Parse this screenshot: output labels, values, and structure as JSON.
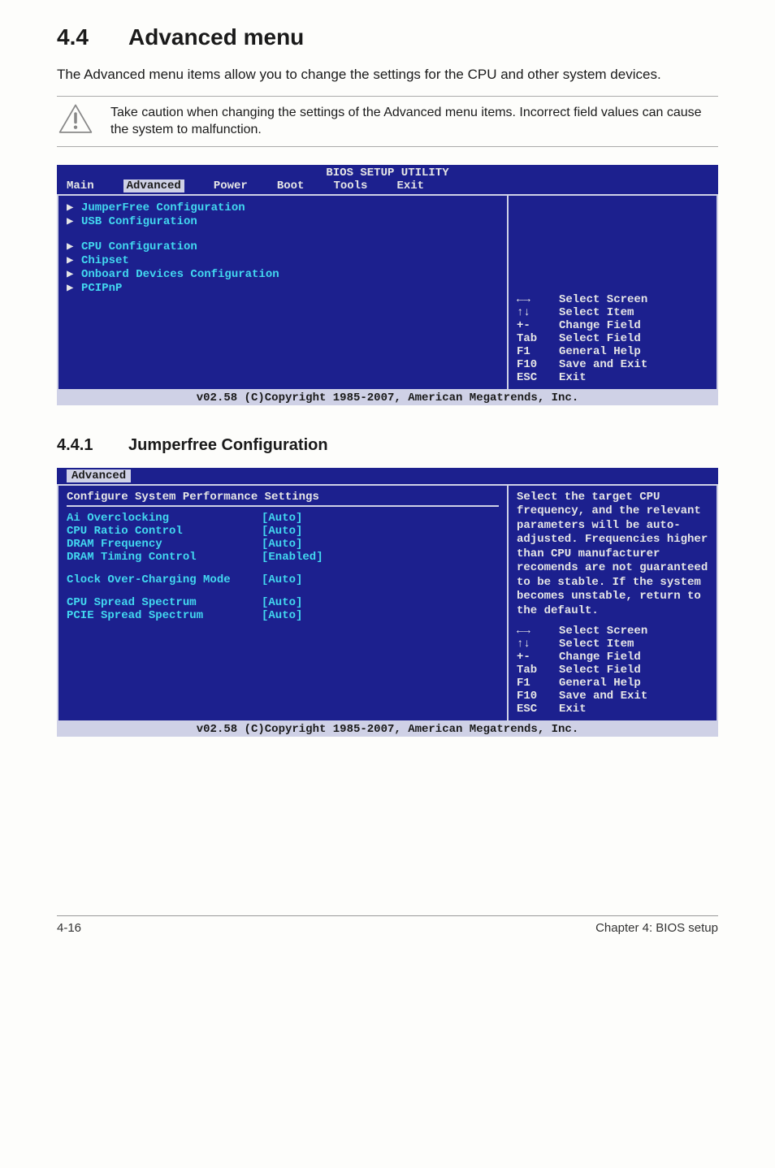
{
  "section": {
    "number": "4.4",
    "title": "Advanced menu",
    "intro": "The Advanced menu items allow you to change the settings for the CPU and other system devices.",
    "caution": "Take caution when changing the settings of the Advanced menu items. Incorrect field values can cause the system to malfunction."
  },
  "bios1": {
    "title": "BIOS SETUP UTILITY",
    "tabs": [
      "Main",
      "Advanced",
      "Power",
      "Boot",
      "Tools",
      "Exit"
    ],
    "activeTab": "Advanced",
    "menu1": [
      "JumperFree Configuration",
      "USB Configuration"
    ],
    "menu2": [
      "CPU Configuration",
      "Chipset",
      "Onboard Devices Configuration",
      "PCIPnP"
    ],
    "keys": [
      {
        "k": "←→",
        "d": "Select Screen"
      },
      {
        "k": "↑↓",
        "d": "Select Item"
      },
      {
        "k": "+-",
        "d": "Change Field"
      },
      {
        "k": "Tab",
        "d": "Select Field"
      },
      {
        "k": "F1",
        "d": "General Help"
      },
      {
        "k": "F10",
        "d": "Save and Exit"
      },
      {
        "k": "ESC",
        "d": "Exit"
      }
    ],
    "footer": "v02.58 (C)Copyright 1985-2007, American Megatrends, Inc."
  },
  "subsection": {
    "number": "4.4.1",
    "title": "Jumperfree Configuration"
  },
  "bios2": {
    "tab": "Advanced",
    "leftTitle": "Configure System Performance Settings",
    "settings": [
      {
        "lbl": "Ai Overclocking",
        "val": "[Auto]"
      },
      {
        "lbl": "CPU Ratio Control",
        "val": "[Auto]"
      },
      {
        "lbl": "DRAM Frequency",
        "val": "[Auto]"
      },
      {
        "lbl": "DRAM Timing Control",
        "val": "[Enabled]"
      }
    ],
    "settings2": [
      {
        "lbl": "Clock Over-Charging Mode",
        "val": "[Auto]"
      }
    ],
    "settings3": [
      {
        "lbl": "CPU Spread Spectrum",
        "val": "[Auto]"
      },
      {
        "lbl": "PCIE Spread Spectrum",
        "val": "[Auto]"
      }
    ],
    "help": "Select the target CPU frequency, and the relevant parameters will be auto-adjusted. Frequencies higher than CPU manufacturer recomends are not guaranteed to be stable. If the system becomes unstable, return to the default.",
    "keys": [
      {
        "k": "←→",
        "d": "Select Screen"
      },
      {
        "k": "↑↓",
        "d": "Select Item"
      },
      {
        "k": "+-",
        "d": "Change Field"
      },
      {
        "k": "Tab",
        "d": "Select Field"
      },
      {
        "k": "F1",
        "d": "General Help"
      },
      {
        "k": "F10",
        "d": "Save and Exit"
      },
      {
        "k": "ESC",
        "d": "Exit"
      }
    ],
    "footer": "v02.58 (C)Copyright 1985-2007, American Megatrends, Inc."
  },
  "pageFooter": {
    "left": "4-16",
    "right": "Chapter 4: BIOS setup"
  }
}
